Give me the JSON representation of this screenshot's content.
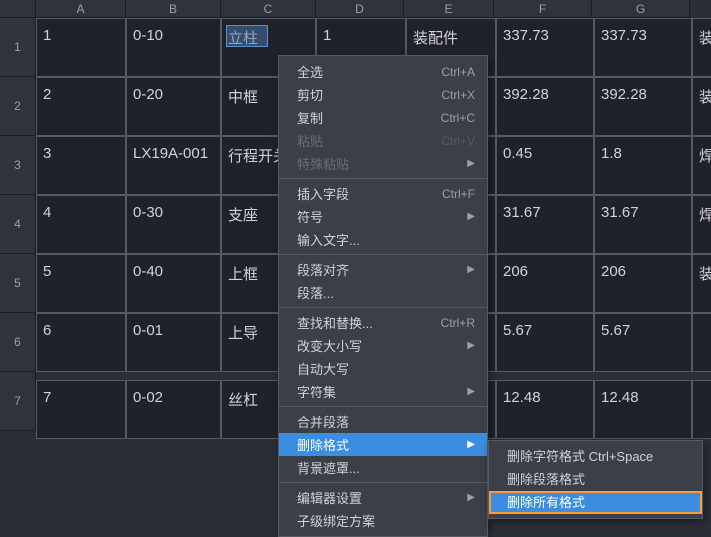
{
  "columns": [
    "A",
    "B",
    "C",
    "D",
    "E",
    "F",
    "G"
  ],
  "row_nums": [
    "1",
    "2",
    "3",
    "4",
    "5",
    "6",
    "7"
  ],
  "rows": [
    {
      "a": "1",
      "b": "0-10",
      "c": "立柱",
      "d": "1",
      "e": "装配件",
      "f": "337.73",
      "g": "337.73",
      "h": "装"
    },
    {
      "a": "2",
      "b": "0-20",
      "c": "中框",
      "d": "",
      "e": "",
      "f": "392.28",
      "g": "392.28",
      "h": "装"
    },
    {
      "a": "3",
      "b": "LX19A-001",
      "c": "行程开关",
      "d": "",
      "e": "",
      "f": "0.45",
      "g": "1.8",
      "h": "焊"
    },
    {
      "a": "4",
      "b": "0-30",
      "c": "支座",
      "d": "",
      "e": "",
      "f": "31.67",
      "g": "31.67",
      "h": "焊"
    },
    {
      "a": "5",
      "b": "0-40",
      "c": "上框",
      "d": "",
      "e": "",
      "f": "206",
      "g": "206",
      "h": "装"
    },
    {
      "a": "6",
      "b": "0-01",
      "c": "上导",
      "d": "",
      "e": "",
      "f": "5.67",
      "g": "5.67",
      "h": ""
    },
    {
      "a": "7",
      "b": "0-02",
      "c": "丝杠",
      "d": "",
      "e": "",
      "f": "12.48",
      "g": "12.48",
      "h": ""
    }
  ],
  "menu": {
    "select_all": "全选",
    "select_all_key": "Ctrl+A",
    "cut": "剪切",
    "cut_key": "Ctrl+X",
    "copy": "复制",
    "copy_key": "Ctrl+C",
    "paste": "粘贴",
    "paste_key": "Ctrl+V",
    "paste_special": "特殊粘贴",
    "insert_field": "插入字段",
    "insert_field_key": "Ctrl+F",
    "symbol": "符号",
    "input_text": "输入文字...",
    "para_align": "段落对齐",
    "paragraph": "段落...",
    "find_replace": "查找和替换...",
    "find_replace_key": "Ctrl+R",
    "change_case": "改变大小写",
    "auto_caps": "自动大写",
    "char_set": "字符集",
    "merge_para": "合并段落",
    "remove_fmt": "删除格式",
    "bg_mask": "背景遮罩...",
    "editor_settings": "编辑器设置",
    "last": "子级绑定方案"
  },
  "submenu": {
    "remove_char_fmt": "删除字符格式 Ctrl+Space",
    "remove_para_fmt": "删除段落格式",
    "remove_all_fmt": "删除所有格式"
  }
}
